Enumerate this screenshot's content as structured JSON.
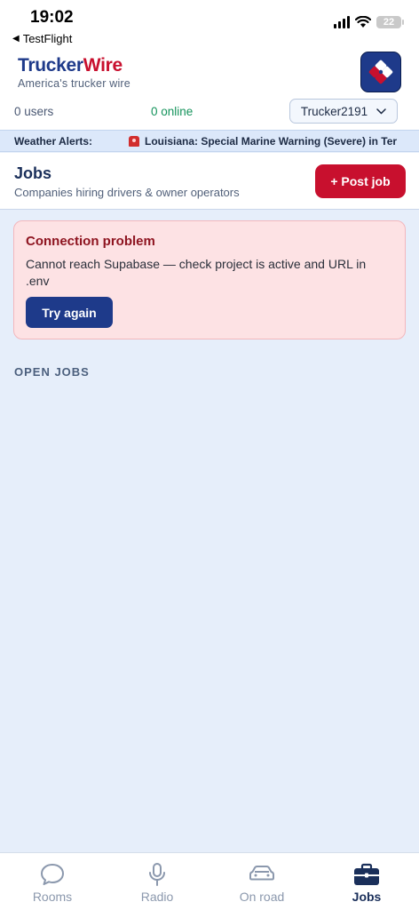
{
  "status_bar": {
    "time": "19:02",
    "back_app": "TestFlight",
    "battery": "22"
  },
  "header": {
    "brand_part1": "Trucker",
    "brand_part2": "Wire",
    "tagline": "America's trucker wire",
    "users_count": "0 users",
    "online_count": "0 online",
    "current_user": "Trucker2191"
  },
  "alert_ticker": {
    "label": "Weather Alerts:",
    "text": "Louisiana: Special Marine Warning (Severe) in Ter"
  },
  "jobs": {
    "title": "Jobs",
    "subtitle": "Companies hiring drivers & owner operators",
    "post_button": "+ Post job",
    "error_title": "Connection problem",
    "error_message": "Cannot reach Supabase — check project is active and URL in .env",
    "retry_button": "Try again",
    "section_label": "OPEN JOBS"
  },
  "tabs": [
    {
      "label": "Rooms",
      "icon": "chat-bubble-icon",
      "active": false
    },
    {
      "label": "Radio",
      "icon": "microphone-icon",
      "active": false
    },
    {
      "label": "On road",
      "icon": "car-icon",
      "active": false
    },
    {
      "label": "Jobs",
      "icon": "briefcase-icon",
      "active": true
    }
  ],
  "colors": {
    "brand_blue": "#1e3a8a",
    "brand_red": "#c8102e",
    "online_green": "#14935b",
    "background": "#e6eefa",
    "error_bg": "#fde2e4"
  }
}
